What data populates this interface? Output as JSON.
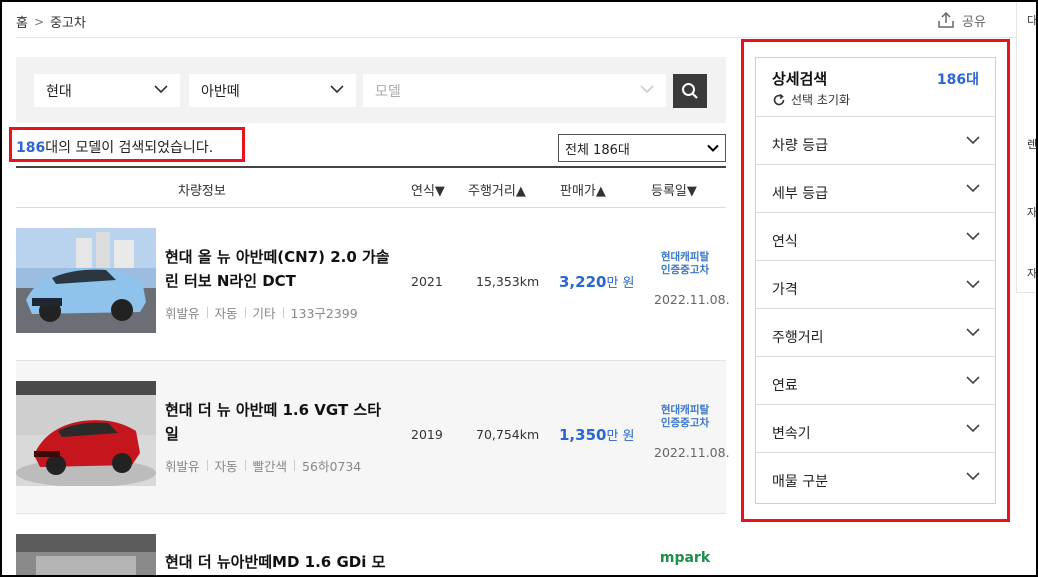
{
  "breadcrumb": {
    "home": "홈",
    "separator": ">",
    "current": "중고차"
  },
  "share": {
    "label": "공유"
  },
  "side_cut": {
    "chars": [
      "다",
      "렌",
      "자",
      "자"
    ]
  },
  "search": {
    "maker": "현대",
    "model": "아반떼",
    "detail_placeholder": "모델"
  },
  "result": {
    "count": "186",
    "suffix": "대의 모델이 검색되었습니다."
  },
  "total_select": {
    "value": "전체 186대"
  },
  "table_header": {
    "info": "차량정보",
    "year": "연식▼",
    "mileage": "주행거리▲",
    "price": "판매가▲",
    "date": "등록일▼"
  },
  "listings": [
    {
      "title": "현대 올 뉴 아반떼(CN7) 2.0 가솔린 터보 N라인 DCT",
      "fuel": "휘발유",
      "transmission": "자동",
      "color": "기타",
      "plate": "133구2399",
      "year": "2021",
      "mileage": "15,353km",
      "price": "3,220",
      "price_unit": "만 원",
      "dealer_line1": "현대캐피탈",
      "dealer_line2": "인증중고차",
      "date": "2022.11.08."
    },
    {
      "title": "현대 더 뉴 아반떼 1.6 VGT 스타일",
      "fuel": "휘발유",
      "transmission": "자동",
      "color": "빨간색",
      "plate": "56하0734",
      "year": "2019",
      "mileage": "70,754km",
      "price": "1,350",
      "price_unit": "만 원",
      "dealer_line1": "현대캐피탈",
      "dealer_line2": "인증중고차",
      "date": "2022.11.08."
    },
    {
      "title": "현대 더 뉴아반떼MD 1.6 GDi 모",
      "dealer_logo": "mpark"
    }
  ],
  "filter": {
    "title": "상세검색",
    "count": "186대",
    "reset": "선택 초기화",
    "items": [
      "차량 등급",
      "세부 등급",
      "연식",
      "가격",
      "주행거리",
      "연료",
      "변속기",
      "매물 구분"
    ]
  },
  "colors": {
    "accent_blue": "#2a66d4",
    "highlight_red": "#e8141d",
    "mpark_green": "#1f8f4c"
  }
}
